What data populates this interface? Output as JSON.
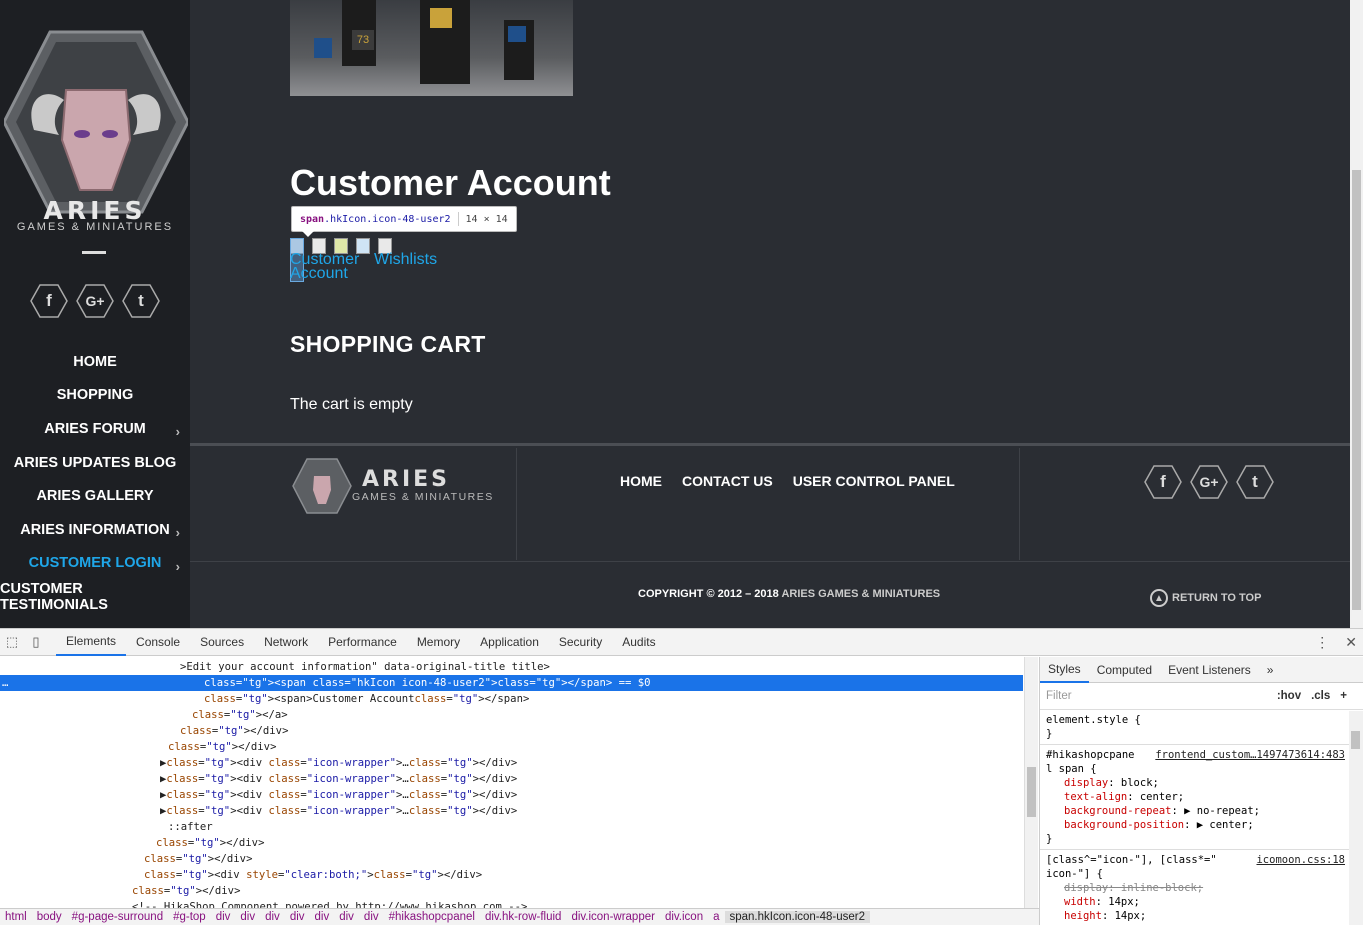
{
  "site": {
    "logo_text": "ARIES",
    "logo_sub": "GAMES & MINIATURES",
    "social": [
      "f",
      "G+",
      "t"
    ],
    "menu": [
      {
        "label": "HOME",
        "submenu": false
      },
      {
        "label": "SHOPPING",
        "submenu": false
      },
      {
        "label": "ARIES FORUM",
        "submenu": true
      },
      {
        "label": "ARIES UPDATES BLOG",
        "submenu": false
      },
      {
        "label": "ARIES GALLERY",
        "submenu": false
      },
      {
        "label": "ARIES INFORMATION",
        "submenu": true
      },
      {
        "label": "CUSTOMER LOGIN",
        "submenu": true,
        "active": true
      },
      {
        "label": "CUSTOMER TESTIMONIALS",
        "submenu": false
      }
    ],
    "banner_number": "73"
  },
  "main": {
    "title": "Customer Account",
    "tooltip": {
      "selector_tag": "span",
      "selector_class": ".hkIcon.icon-48-user2",
      "size": "14 × 14"
    },
    "account_link_1": "Customer",
    "account_link_2": "Account",
    "account_link_wishlists": "Wishlists",
    "cart_title": "SHOPPING CART",
    "cart_empty": "The cart is empty"
  },
  "footer": {
    "nav": [
      "HOME",
      "CONTACT US",
      "USER CONTROL PANEL"
    ],
    "copyright": "COPYRIGHT © 2012 – 2018 ",
    "copyright_brand": "ARIES GAMES & MINIATURES",
    "return_top": "RETURN TO TOP"
  },
  "devtools": {
    "tabs": [
      "Elements",
      "Console",
      "Sources",
      "Network",
      "Performance",
      "Memory",
      "Application",
      "Security",
      "Audits"
    ],
    "active_tab": "Elements",
    "dom_lines": [
      {
        "indent": 180,
        "text": ">Edit your account information\" data-original-title title>"
      },
      {
        "indent": 204,
        "text": "<span class=\"hkIcon icon-48-user2\"></span> == $0",
        "selected": true
      },
      {
        "indent": 204,
        "text": "<span>Customer Account</span>"
      },
      {
        "indent": 192,
        "text": "</a>"
      },
      {
        "indent": 180,
        "text": "</div>"
      },
      {
        "indent": 168,
        "text": "</div>"
      },
      {
        "indent": 160,
        "text": "▶<div class=\"icon-wrapper\">…</div>"
      },
      {
        "indent": 160,
        "text": "▶<div class=\"icon-wrapper\">…</div>"
      },
      {
        "indent": 160,
        "text": "▶<div class=\"icon-wrapper\">…</div>"
      },
      {
        "indent": 160,
        "text": "▶<div class=\"icon-wrapper\">…</div>"
      },
      {
        "indent": 168,
        "text": "::after"
      },
      {
        "indent": 156,
        "text": "</div>"
      },
      {
        "indent": 144,
        "text": "</div>"
      },
      {
        "indent": 144,
        "text": "<div style=\"clear:both;\"></div>"
      },
      {
        "indent": 132,
        "text": "</div>"
      },
      {
        "indent": 132,
        "text": "<!-- HikaShop Component powered by http://www.hikashop.com -->"
      }
    ],
    "breadcrumbs": [
      "html",
      "body",
      "#g-page-surround",
      "#g-top",
      "div",
      "div",
      "div",
      "div",
      "div",
      "div",
      "div",
      "#hikashopcpanel",
      "div.hk-row-fluid",
      "div.icon-wrapper",
      "div.icon",
      "a",
      "span.hkIcon.icon-48-user2"
    ],
    "styles_tabs": [
      "Styles",
      "Computed",
      "Event Listeners",
      "»"
    ],
    "filter_placeholder": "Filter",
    "filter_tools": [
      ":hov",
      ".cls",
      "+"
    ],
    "rules": [
      {
        "selector": "element.style {",
        "source": "",
        "props": [],
        "close": "}"
      },
      {
        "selector": "#hikashopcpane",
        "source": "frontend_custom…1497473614:483",
        "selector2": "l span {",
        "props": [
          {
            "name": "display",
            "value": "block;"
          },
          {
            "name": "text-align",
            "value": "center;"
          },
          {
            "name": "background-repeat",
            "value": "▶ no-repeat;"
          },
          {
            "name": "background-position",
            "value": "▶ center;"
          }
        ],
        "close": "}"
      },
      {
        "selector": "[class^=\"icon-\"], [class*=\"",
        "source": "icomoon.css:18",
        "selector2": "icon-\"] {",
        "props": [
          {
            "name": "display",
            "value": "inline-block;",
            "struck": true
          },
          {
            "name": "width",
            "value": "14px;"
          },
          {
            "name": "height",
            "value": "14px;"
          }
        ],
        "close": ""
      }
    ]
  }
}
